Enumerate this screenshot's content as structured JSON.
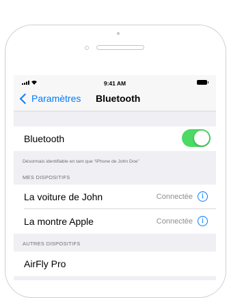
{
  "status_bar": {
    "time": "9:41 AM",
    "signal_icon": "cellular-signal-icon",
    "wifi_icon": "wifi-icon",
    "battery_icon": "battery-icon"
  },
  "nav": {
    "back_label": "Paramètres",
    "title": "Bluetooth"
  },
  "bluetooth_row": {
    "label": "Bluetooth",
    "enabled": true
  },
  "footnote": "Désormais identifiable en tant que “iPhone de John Doe”",
  "my_devices": {
    "header": "MES DISPOSITIFS",
    "items": [
      {
        "name": "La voiture de John",
        "status": "Connectée"
      },
      {
        "name": "La montre Apple",
        "status": "Connectée"
      }
    ]
  },
  "other_devices": {
    "header": "AUTRES DISPOSITIFS",
    "items": [
      {
        "name": "AirFly Pro"
      }
    ]
  },
  "colors": {
    "accent": "#007aff",
    "toggle_on": "#4cd964",
    "group_bg": "#efeff4"
  }
}
